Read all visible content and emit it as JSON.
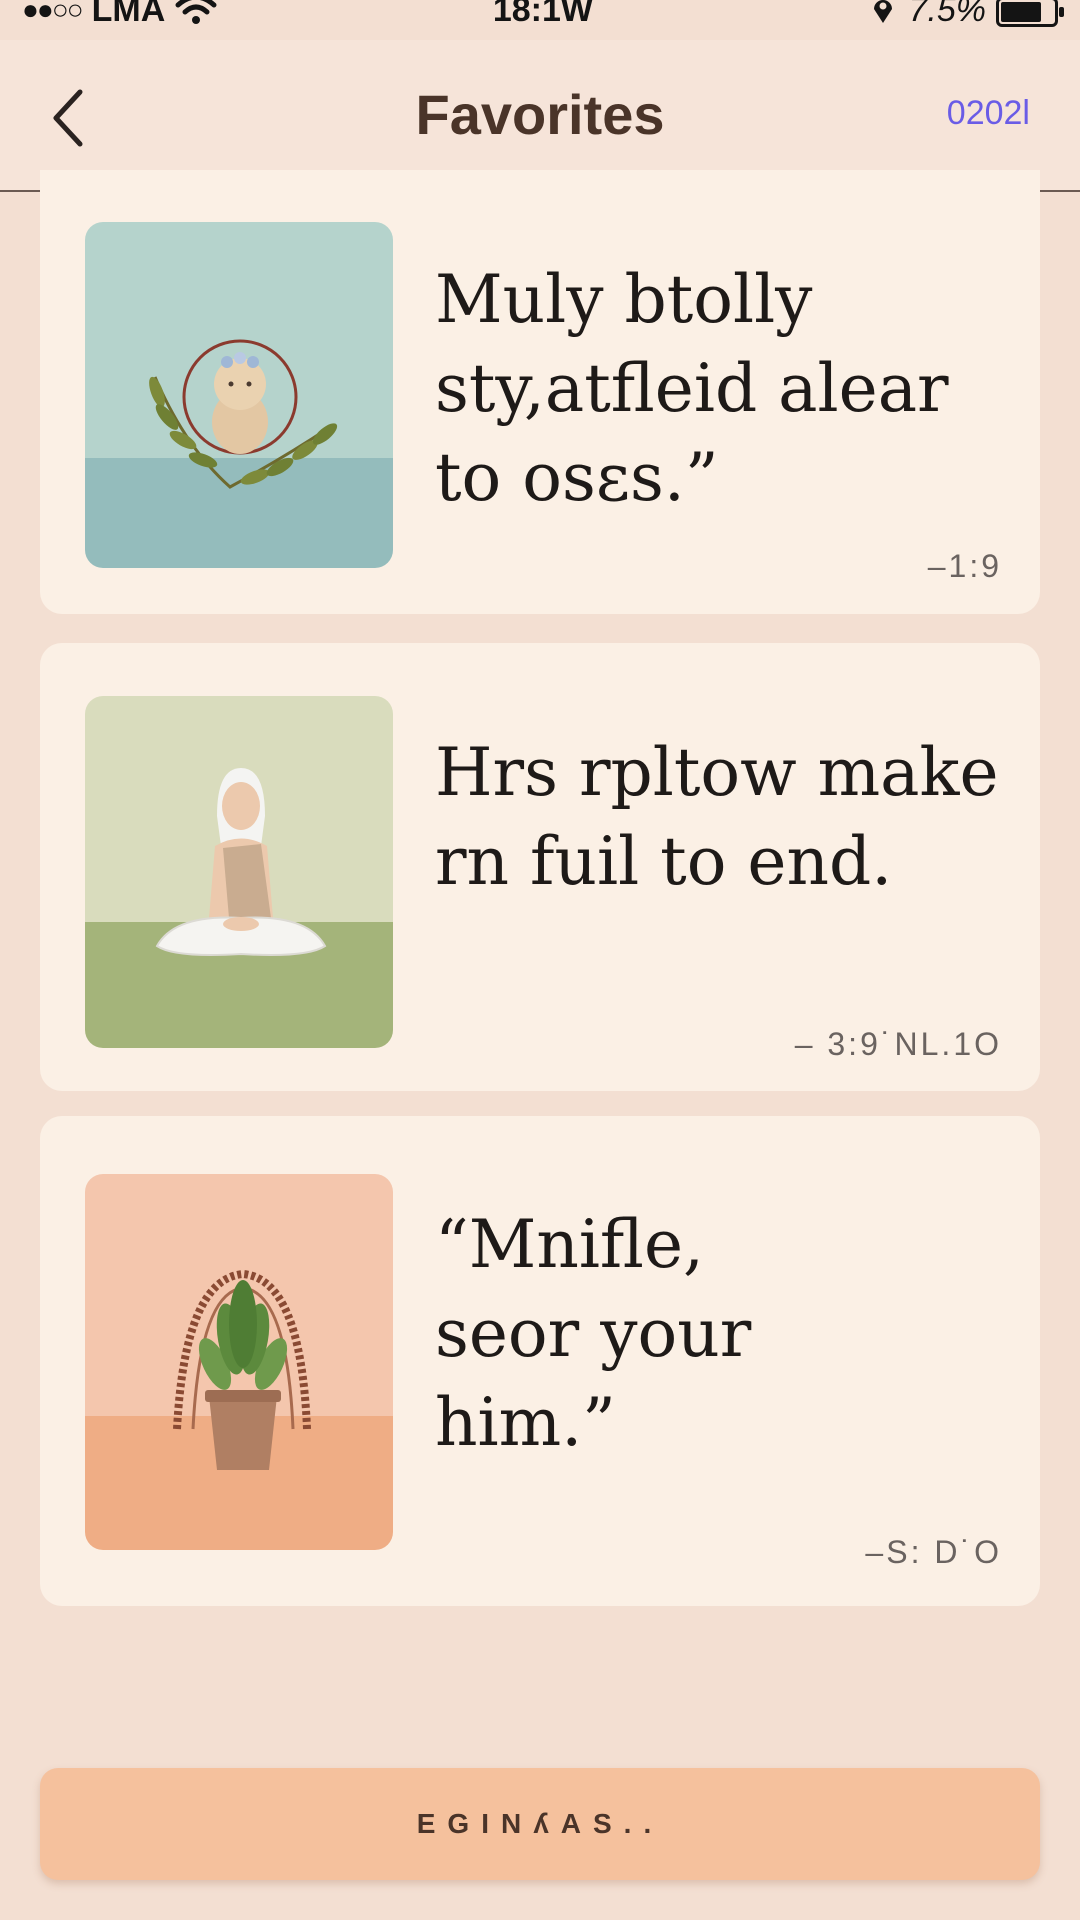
{
  "status_bar": {
    "carrier": "LMA",
    "time": "18:1W",
    "battery": "7.5%"
  },
  "nav": {
    "title": "Favorites",
    "action_label": "0202l"
  },
  "favorites": [
    {
      "quote_lines": [
        "Muly btolly",
        "sty,atfleid alear",
        "to osεs.”"
      ],
      "attribution": "–1:9",
      "illustration": "wreath-mirror-illustration",
      "colors": {
        "top": "#b5d3cc",
        "bottom": "#94bcbc"
      }
    },
    {
      "quote_lines": [
        "Hrs rpltow make",
        "rn fuil to end."
      ],
      "attribution": "– 3:9˙NL.1O",
      "illustration": "meditating-figure-illustration",
      "colors": {
        "top": "#d9dcbd",
        "bottom": "#a4b47a"
      }
    },
    {
      "quote_lines": [
        "“Mnifle,",
        "seor your",
        "him.”"
      ],
      "attribution": "–S: D˙O",
      "illustration": "hanging-plant-illustration",
      "colors": {
        "top": "#f4c6ad",
        "bottom": "#efad85"
      }
    }
  ],
  "bottom_button": {
    "label": "EGINʎAS.."
  }
}
